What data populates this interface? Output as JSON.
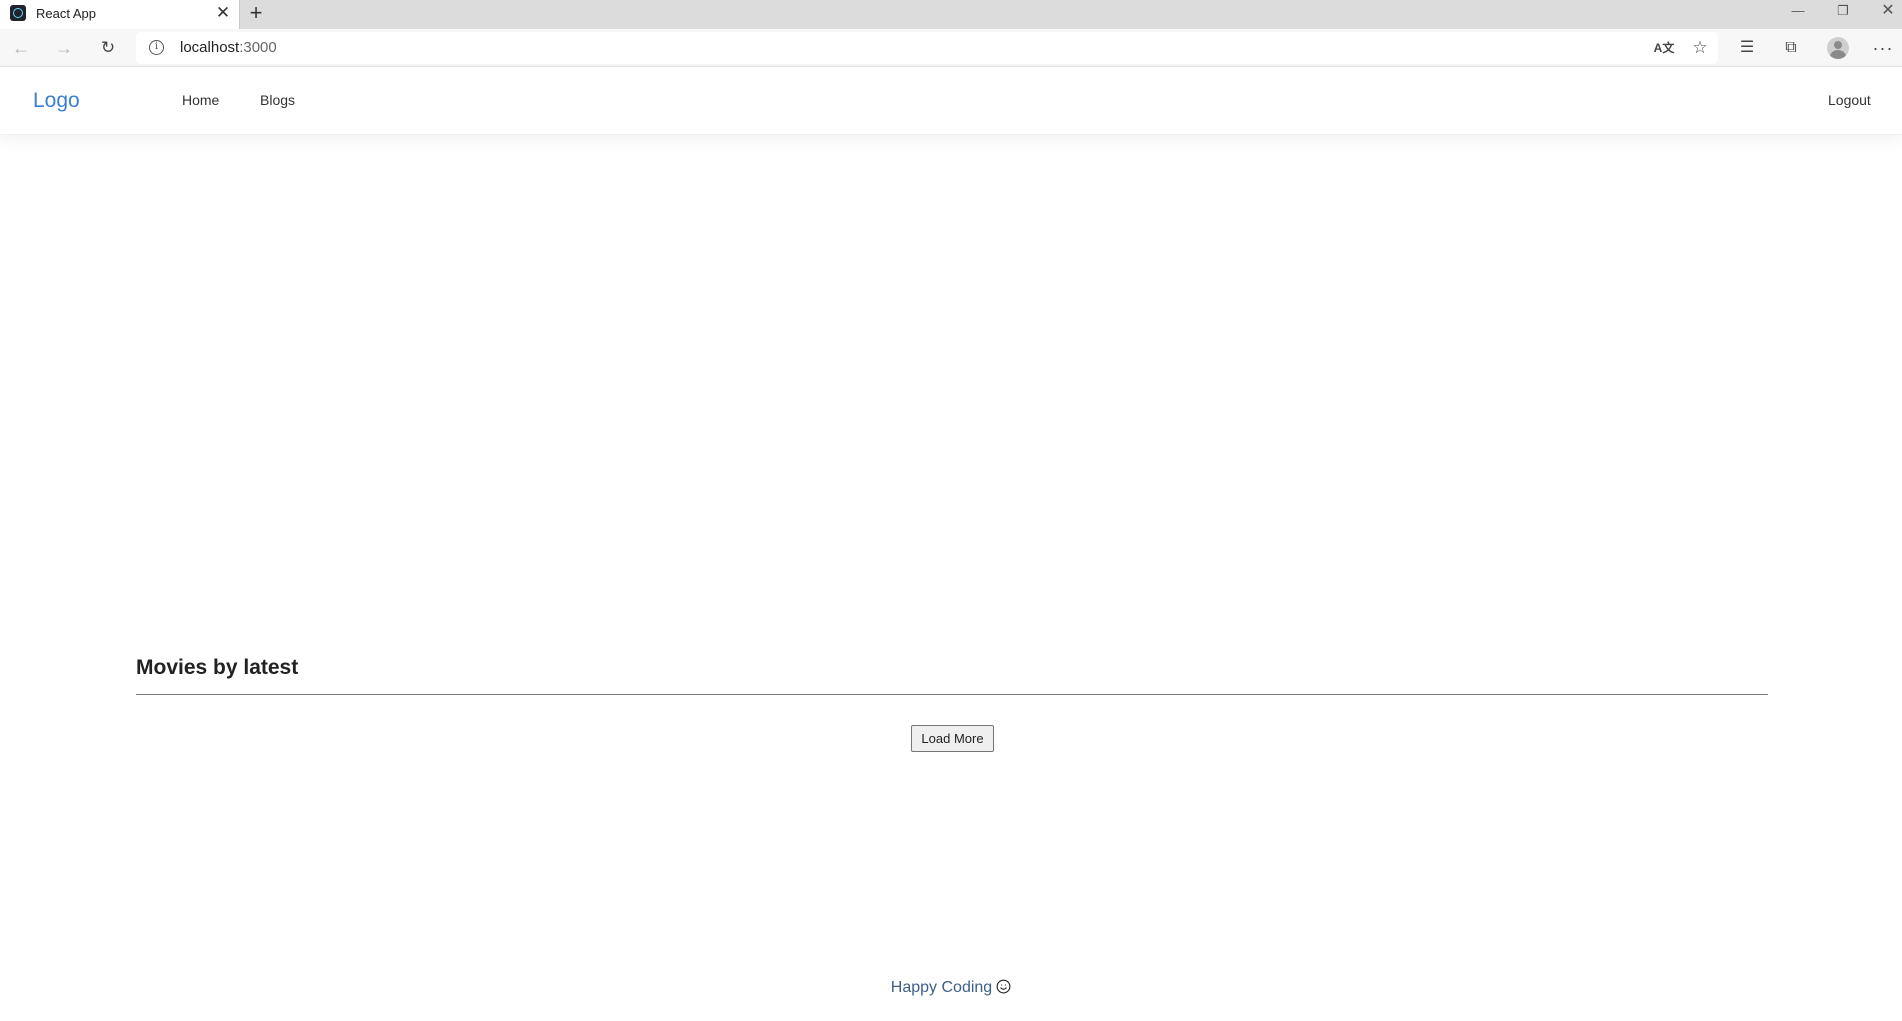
{
  "browser": {
    "tab": {
      "title": "React App",
      "favicon": "react-icon",
      "close_symbol": "✕"
    },
    "new_tab_symbol": "+",
    "window_controls": {
      "minimize": "—",
      "restore": "❐",
      "close": "✕"
    },
    "nav": {
      "back": "←",
      "forward": "→",
      "reload": "↻"
    },
    "address": {
      "host": "localhost",
      "port": ":3000",
      "info_symbol": "i"
    },
    "toolbar_icons": {
      "translate": "A文",
      "favorite": "☆",
      "favorites_list": "☰",
      "collections": "⧉",
      "more": "···"
    }
  },
  "app": {
    "navbar": {
      "logo": "Logo",
      "links": [
        "Home",
        "Blogs"
      ],
      "logout": "Logout"
    },
    "section": {
      "title": "Movies by latest"
    },
    "load_more_label": "Load More",
    "footer": {
      "text": "Happy Coding",
      "icon": "smile-icon"
    }
  },
  "colors": {
    "logo": "#3b7fd0",
    "footer_text": "#3e5f86",
    "divider": "#7a7a7a",
    "tab_strip": "#dcdcdc"
  }
}
